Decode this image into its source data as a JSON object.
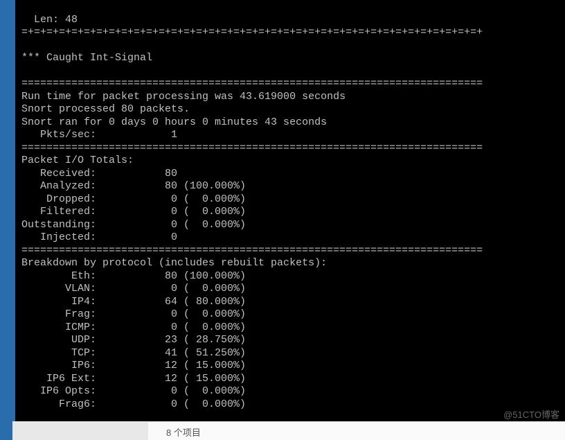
{
  "terminal": {
    "len_line": "  Len: 48",
    "divider1": "=+=+=+=+=+=+=+=+=+=+=+=+=+=+=+=+=+=+=+=+=+=+=+=+=+=+=+=+=+=+=+=+=+=+=+=+=+",
    "caught": "*** Caught Int-Signal",
    "divider2": "==========================================================================",
    "run_time": "Run time for packet processing was 43.619000 seconds",
    "processed": "Snort processed 80 packets.",
    "ran_for": "Snort ran for 0 days 0 hours 0 minutes 43 seconds",
    "pkts_sec": "   Pkts/sec:            1",
    "divider3": "==========================================================================",
    "io_header": "Packet I/O Totals:",
    "io": [
      "   Received:           80",
      "   Analyzed:           80 (100.000%)",
      "    Dropped:            0 (  0.000%)",
      "   Filtered:            0 (  0.000%)",
      "Outstanding:            0 (  0.000%)",
      "   Injected:            0"
    ],
    "divider4": "==========================================================================",
    "breakdown_header": "Breakdown by protocol (includes rebuilt packets):",
    "proto": [
      "        Eth:           80 (100.000%)",
      "       VLAN:            0 (  0.000%)",
      "        IP4:           64 ( 80.000%)",
      "       Frag:            0 (  0.000%)",
      "       ICMP:            0 (  0.000%)",
      "        UDP:           23 ( 28.750%)",
      "        TCP:           41 ( 51.250%)",
      "        IP6:           12 ( 15.000%)",
      "    IP6 Ext:           12 ( 15.000%)",
      "   IP6 Opts:            0 (  0.000%)",
      "      Frag6:            0 (  0.000%)"
    ]
  },
  "bottom_bar": {
    "label": "8 个项目"
  },
  "watermark": "@51CTO博客"
}
